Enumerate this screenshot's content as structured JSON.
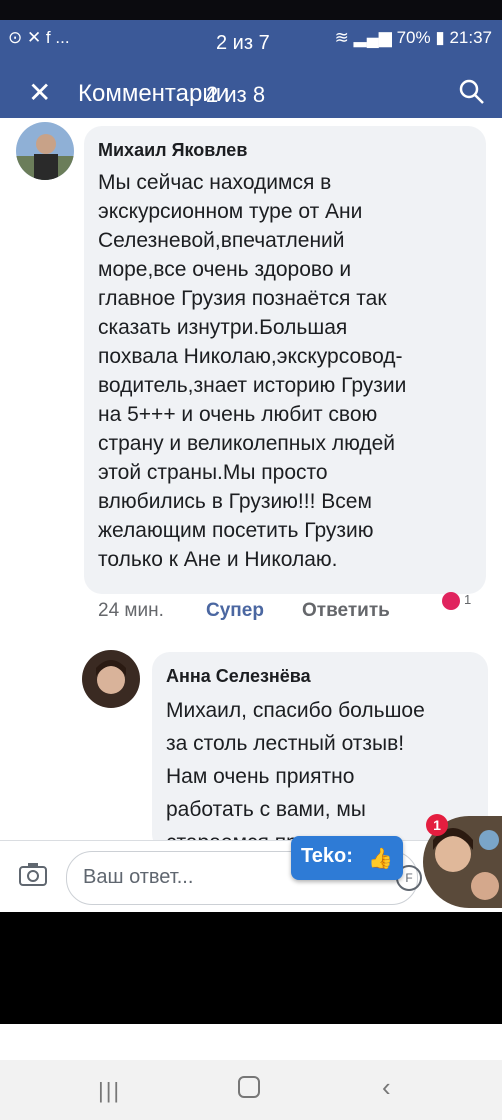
{
  "status": {
    "left_icons": "⊙ ✕ f ...",
    "image_counter": "2 из 7",
    "battery": "70%",
    "time": "21:37"
  },
  "header": {
    "title": "Комментарии",
    "counter_overlay": "2 из 8"
  },
  "comments": [
    {
      "author": "Михаил Яковлев",
      "text": "Мы сейчас находимся в\nэкскурсионном туре от Ани\nСелезневой,впечатлений\nморе,все очень здорово и\nглавное Грузия познаётся так\nсказать изнутри.Большая\nпохвала Николаю,экскурсовод-\nводитель,знает историю Грузии\nна 5+++ и очень любит свою\nстрану и великолепных людей\nэтой страны.Мы просто\nвлюбились в Грузию!!! Всем\nжелающим посетить Грузию\nтолько к Ане и Николаю.",
      "time": "24 мин.",
      "like_label": "Супер",
      "reply_label": "Ответить",
      "reactions": "1"
    },
    {
      "author": "Анна Селезнёва",
      "text": "Михаил, спасибо большое\nза столь лестный отзыв!\nНам очень приятно\nработать с вами, мы\nстараемся проводить"
    }
  ],
  "reply_bar": {
    "placeholder": "Ваш ответ...",
    "gif_label": "F"
  },
  "sticker": {
    "text": "Teko:",
    "icon": "thumbs-up-icon"
  },
  "chat_head": {
    "badge": "1"
  },
  "colors": {
    "header_bg": "#3b5998",
    "bubble_bg": "#f0f2f5",
    "like_color": "#4b67a1",
    "sticker_bg": "#2e7bd6"
  }
}
